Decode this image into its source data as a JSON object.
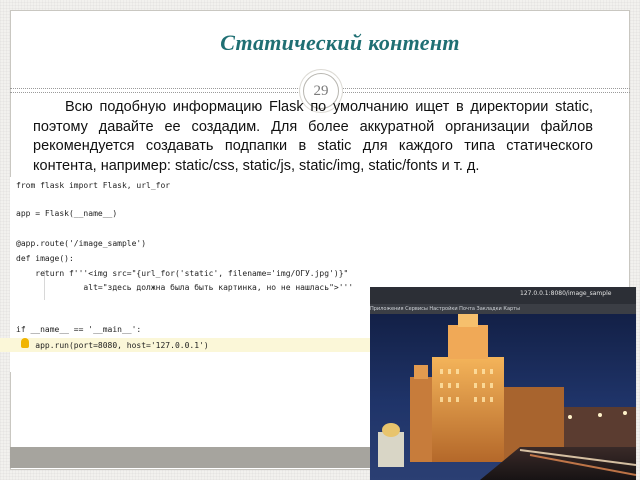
{
  "slide": {
    "title": "Статический контент",
    "page_number": "29",
    "paragraph": "Всю подобную информацию Flask по умолчанию ищет в директории static, поэтому давайте ее создадим. Для более аккуратной организации файлов рекомендуется создавать подпапки в static для каждого типа статического контента, например: static/css, static/js, static/img, static/fonts и т. д.",
    "paragraph_visible_tail": "static/fonts и т. д."
  },
  "code": {
    "lines": [
      "from flask import Flask, url_for",
      "",
      "app = Flask(__name__)",
      "",
      "@app.route('/image_sample')",
      "def image():",
      "    return f'''<img src=\"{url_for('static', filename='img/ОГУ.jpg')}\"",
      "              alt=\"здесь должна была быть картинка, но не нашлась\">'''",
      "",
      "",
      "if __name__ == '__main__':",
      "    app.run(port=8080, host='127.0.0.1')"
    ]
  },
  "photo": {
    "browser_url": "127.0.0.1:8080/image_sample",
    "tab_labels": "Приложения  Сервисы  Настройки  Почта  Закладки  Карты"
  },
  "colors": {
    "title": "#1f6f73",
    "frame_border": "#c9c7c1",
    "bottom_bar": "#a6a49e"
  }
}
